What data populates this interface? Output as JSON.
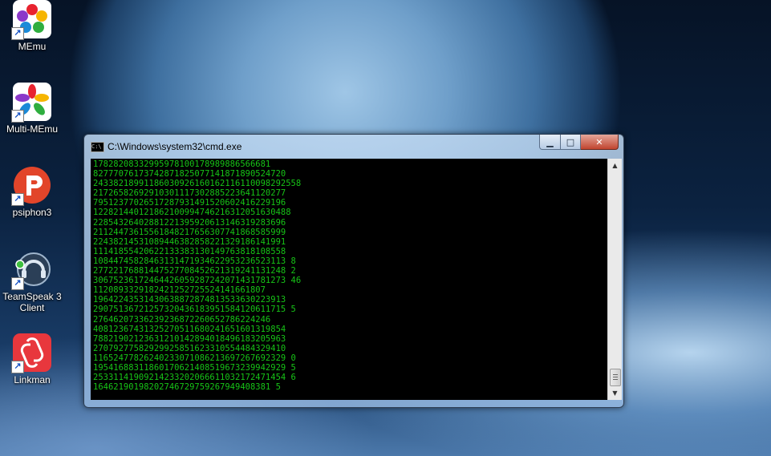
{
  "desktop_icons": [
    {
      "label": "MEmu",
      "icon": "memu-icon"
    },
    {
      "label": "Multi-MEmu",
      "icon": "multi-memu-icon"
    },
    {
      "label": "psiphon3",
      "icon": "psiphon-icon"
    },
    {
      "label": "TeamSpeak 3 Client",
      "icon": "teamspeak-icon"
    },
    {
      "label": "Linkman",
      "icon": "linkman-icon"
    }
  ],
  "window": {
    "title": "C:\\Windows\\system32\\cmd.exe",
    "buttons": {
      "minimize": "▁",
      "maximize": "□",
      "close": "✕"
    }
  },
  "console": {
    "text_color": "#17c417",
    "lines": [
      "17828208332995978100178989886566681",
      "82777076173742871825077141871890524720",
      "24338218991186030926160162116110098292558",
      "21726582692910301117302885223641120277",
      "79512377026517287931491520602416229196",
      "122821440121862100994746216312051630488",
      "22854326402881221395920613146319283696",
      "21124473615561848217656307741868585999",
      "22438214531089446382858221329186141991",
      "11141855420622133383130149763818108558",
      "10844745828463131471934622953236523113 8",
      "27722176881447527708452621319241131248 2",
      "30675236172464426059287242071431781273 46",
      "1120893329182421252725524141661807",
      "19642243531430638872874813533630223913",
      "29075136721257320436183951584120611715 5",
      "27646207336239236872260652786224246",
      "40812367431325270511680241651601319854",
      "78821902123631210142894018496183205963",
      "27079277582929925851623310554484329410",
      "11652477826240233071086213697267692329 0",
      "19541688311860170621408519673239942929 5",
      "25331141909214233202066611032172471454 6",
      "16462190198202746729759267949408381 5"
    ]
  }
}
